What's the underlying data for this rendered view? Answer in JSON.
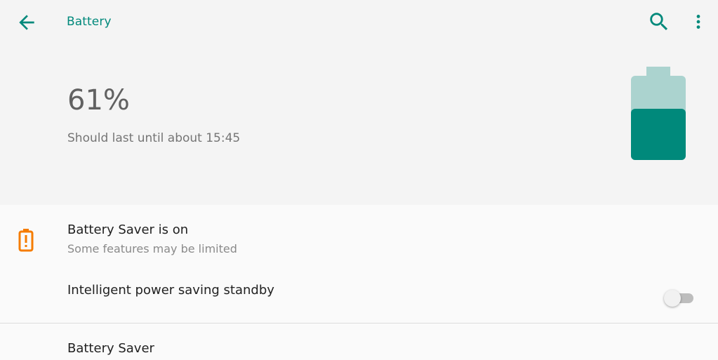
{
  "app_bar": {
    "title": "Battery",
    "back_icon": "arrow-back-icon",
    "search_icon": "search-icon",
    "more_icon": "more-vert-icon",
    "accent_color": "#00897b"
  },
  "battery": {
    "percent_text": "61%",
    "level": 0.61,
    "estimate": "Should last until about 15:45",
    "icon": "battery-level-icon",
    "fill_color": "#00897b",
    "empty_color": "#abd3cf"
  },
  "settings": {
    "battery_saver_status": {
      "title": "Battery Saver is on",
      "subtitle": "Some features may be limited",
      "icon": "battery-alert-icon",
      "icon_color": "#f57c00"
    },
    "intelligent_standby": {
      "title": "Intelligent power saving standby",
      "toggle_on": false
    },
    "battery_saver": {
      "title": "Battery Saver"
    }
  }
}
